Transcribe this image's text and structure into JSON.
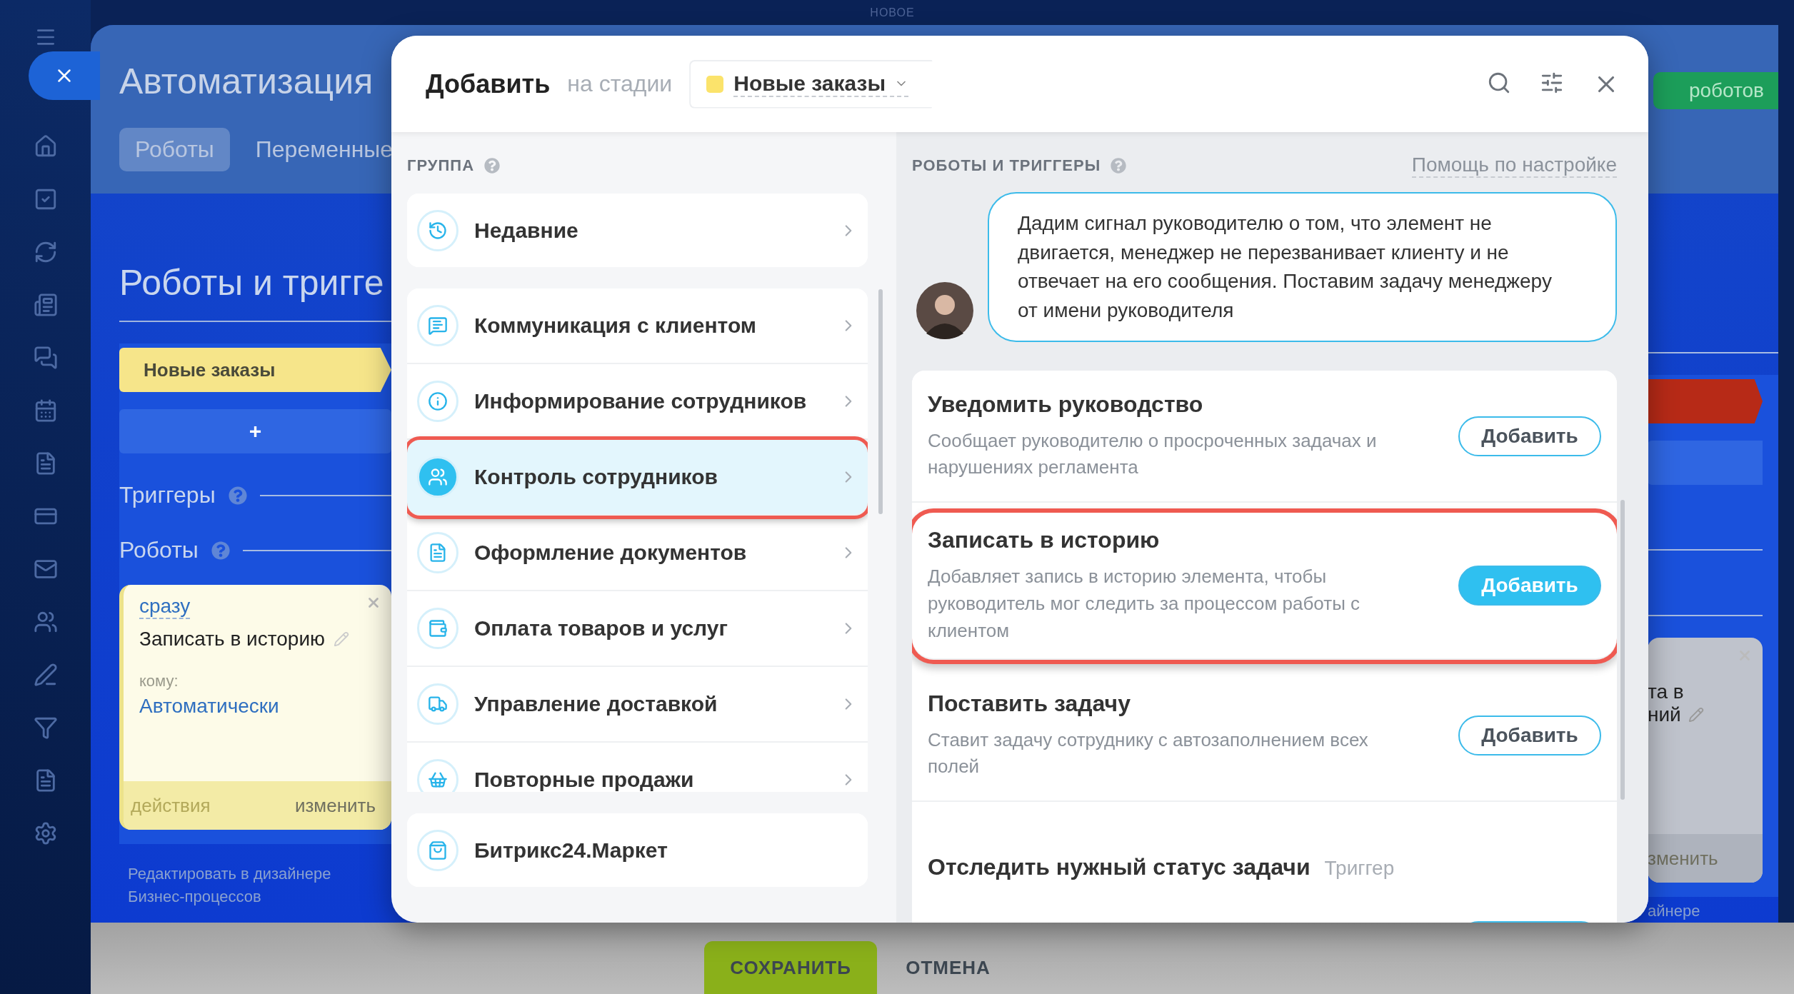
{
  "top_label": "НОВОЕ",
  "page": {
    "title": "Автоматизация",
    "tabs": [
      {
        "label": "Роботы",
        "selected": true
      },
      {
        "label": "Переменные",
        "selected": false
      }
    ],
    "heading": "Роботы и тригге",
    "stage": "Новые заказы",
    "add_stage": "+",
    "triggers_label": "Триггеры",
    "robots_label": "Роботы",
    "robot_card": {
      "timing": "сразу",
      "title": "Записать в историю",
      "to_label": "кому:",
      "to_value": "Автоматически",
      "actions": "действия",
      "edit": "изменить"
    },
    "designer_link": "Редактировать в дизайнере Бизнес-процессов",
    "right_fragments": {
      "button": "роботов",
      "card_line_1": "та в",
      "card_line_2": "ний",
      "card_edit": "зменить",
      "designer": "айнере"
    }
  },
  "modal": {
    "title": "Добавить",
    "stage_label": "на стадии",
    "stage": "Новые заказы",
    "groups_heading": "ГРУППА",
    "recent": "Недавние",
    "groups": [
      {
        "label": "Коммуникация с клиентом",
        "selected": false,
        "highlighted": false
      },
      {
        "label": "Информирование сотрудников",
        "selected": false,
        "highlighted": false
      },
      {
        "label": "Контроль сотрудников",
        "selected": true,
        "highlighted": true
      },
      {
        "label": "Оформление документов",
        "selected": false,
        "highlighted": false
      },
      {
        "label": "Оплата товаров и услуг",
        "selected": false,
        "highlighted": false
      },
      {
        "label": "Управление доставкой",
        "selected": false,
        "highlighted": false
      },
      {
        "label": "Повторные продажи",
        "selected": false,
        "highlighted": false
      }
    ],
    "market": "Битрикс24.Маркет",
    "robots_heading": "РОБОТЫ И ТРИГГЕРЫ",
    "help_link": "Помощь по настройке",
    "tip": "Дадим сигнал руководителю о том, что элемент не двигается, менеджер не перезванивает клиенту и не отвечает на его сообщения. Поставим задачу менеджеру от имени руководителя",
    "robots": [
      {
        "title": "Уведомить руководство",
        "description": "Сообщает руководителю о просроченных задачах и нарушениях регламента",
        "button": "Добавить",
        "highlighted": false
      },
      {
        "title": "Записать в историю",
        "description": "Добавляет запись в историю элемента, чтобы руководитель мог следить за процессом работы с клиентом",
        "button": "Добавить",
        "highlighted": true
      },
      {
        "title": "Поставить задачу",
        "description": "Ставит задачу сотруднику с автозаполнением всех полей",
        "button": "Добавить",
        "highlighted": false
      },
      {
        "title": "Отследить нужный статус задачи",
        "tag": "Триггер",
        "highlighted": false
      }
    ]
  },
  "footer": {
    "save": "СОХРАНИТЬ",
    "cancel": "ОТМЕНА"
  }
}
